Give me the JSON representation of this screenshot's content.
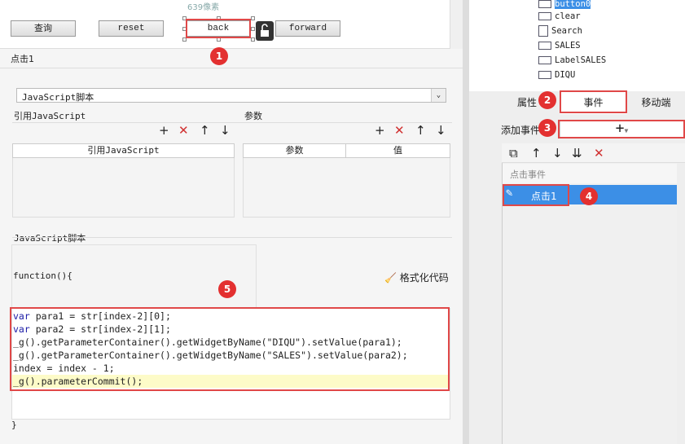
{
  "canvas": {
    "pixel_label": "639像素",
    "buttons": {
      "query": "查询",
      "reset": "reset",
      "back": "back",
      "forward": "forward"
    }
  },
  "editor": {
    "event_title": "点击1",
    "type_select": "JavaScript脚本",
    "ref_js_label": "引用JavaScript",
    "params_label": "参数",
    "ref_js_col": "引用JavaScript",
    "param_col": "参数",
    "value_col": "值",
    "script_section_label": "JavaScript脚本",
    "function_open": "function(){",
    "format_code_label": "格式化代码",
    "function_close": "}",
    "code_lines": [
      "var para1 = str[index-2][0];",
      "var para2 = str[index-2][1];",
      "_g().getParameterContainer().getWidgetByName(\"DIQU\").setValue(para1);",
      "_g().getParameterContainer().getWidgetByName(\"SALES\").setValue(para2);",
      "index = index - 1;",
      "_g().parameterCommit();"
    ]
  },
  "tree": {
    "items": [
      "button0",
      "clear",
      "Search",
      "SALES",
      "LabelSALES",
      "DIQU"
    ]
  },
  "tabs": {
    "properties": "属性",
    "events": "事件",
    "mobile": "移动端"
  },
  "events_panel": {
    "add_event_label": "添加事件",
    "add_symbol": "+",
    "group_label": "点击事件",
    "item_label": "点击1"
  },
  "badges": [
    "1",
    "2",
    "3",
    "4",
    "5"
  ],
  "colors": {
    "highlight_blue": "#3c8fe6",
    "annotation_red": "#e04848"
  }
}
